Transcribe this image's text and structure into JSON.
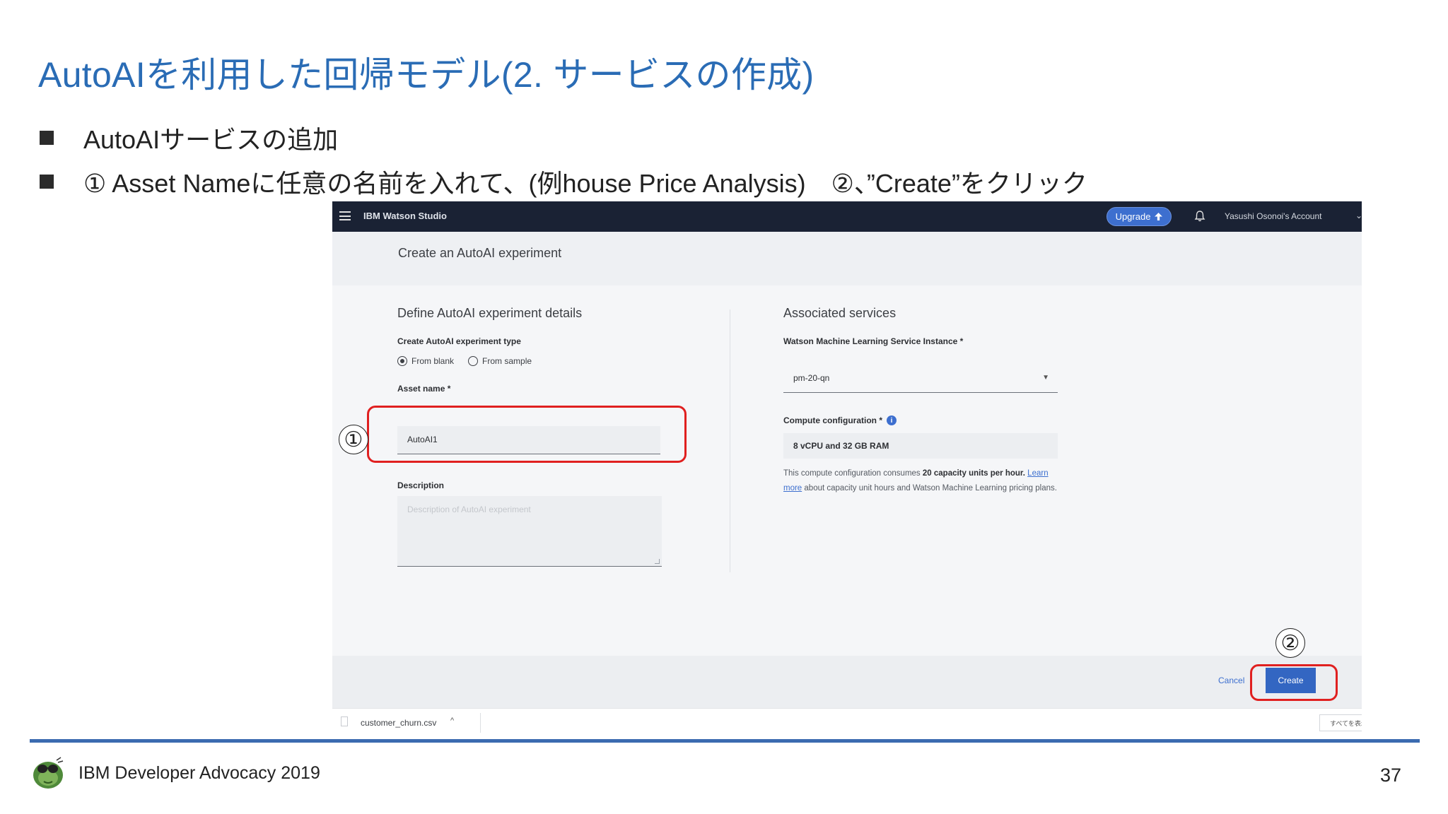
{
  "slide": {
    "title": "AutoAIを利用した回帰モデル(2. サービスの作成)",
    "bullets": [
      "AutoAIサービスの追加",
      "① Asset Nameに任意の名前を入れて、(例house Price Analysis)　②、”Create”をクリック"
    ],
    "footer": "IBM Developer Advocacy 2019",
    "page_number": "37"
  },
  "app": {
    "product_name": "IBM Watson Studio",
    "upgrade_label": "Upgrade",
    "account_name": "Yasushi Osonoi's Account",
    "page_title": "Create an AutoAI experiment",
    "left": {
      "section_title": "Define AutoAI experiment details",
      "type_label": "Create AutoAI experiment type",
      "radio_blank": "From blank",
      "radio_sample": "From sample",
      "asset_label": "Asset name *",
      "asset_value": "AutoAI1",
      "description_label": "Description",
      "description_placeholder": "Description of AutoAI experiment"
    },
    "right": {
      "section_title": "Associated services",
      "instance_label": "Watson Machine Learning Service Instance *",
      "instance_value": "pm-20-qn",
      "compute_label": "Compute configuration *",
      "compute_value": "8 vCPU and 32 GB RAM",
      "note_1": "This compute configuration consumes ",
      "note_bold": "20 capacity units per hour.",
      "note_link": "Learn more",
      "note_2": " about capacity unit hours and Watson Machine Learning pricing plans."
    },
    "cancel_label": "Cancel",
    "create_label": "Create",
    "download_file": "customer_churn.csv",
    "show_all": "すべてを表示"
  },
  "annotations": {
    "callout_1": "①",
    "callout_2": "②",
    "highlight_color": "#e02020"
  },
  "colors": {
    "title_blue": "#2a6cb5",
    "topbar": "#1a2234",
    "primary_button": "#3366c2",
    "rule_blue": "#3b6bb0"
  }
}
